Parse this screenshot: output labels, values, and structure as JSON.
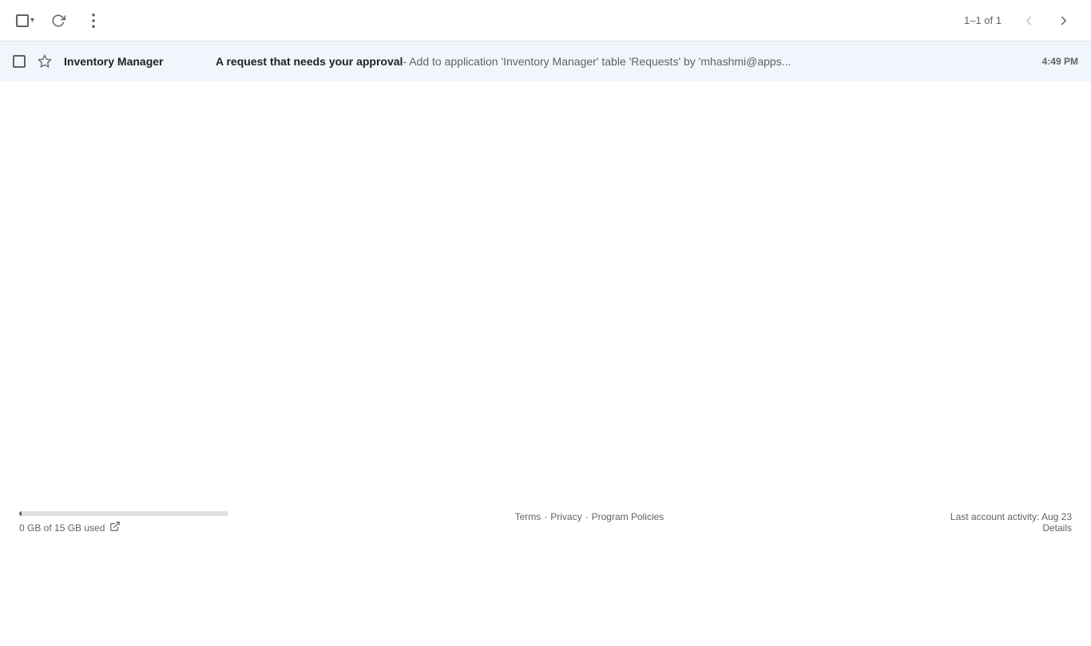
{
  "toolbar": {
    "refresh_title": "Refresh",
    "more_title": "More",
    "pagination": "1–1 of 1",
    "prev_label": "‹",
    "next_label": "›"
  },
  "email": {
    "sender": "Inventory Manager",
    "subject_bold": "A request that needs your approval",
    "subject_preview": " - Add to application 'Inventory Manager' table 'Requests' by 'mhashmi@apps...",
    "time": "4:49 PM"
  },
  "footer": {
    "storage_used": "0 GB of 15 GB used",
    "storage_fill_percent": "1",
    "terms_label": "Terms",
    "privacy_label": "Privacy",
    "program_policies_label": "Program Policies",
    "last_activity_label": "Last account activity: Aug 23",
    "details_label": "Details"
  }
}
